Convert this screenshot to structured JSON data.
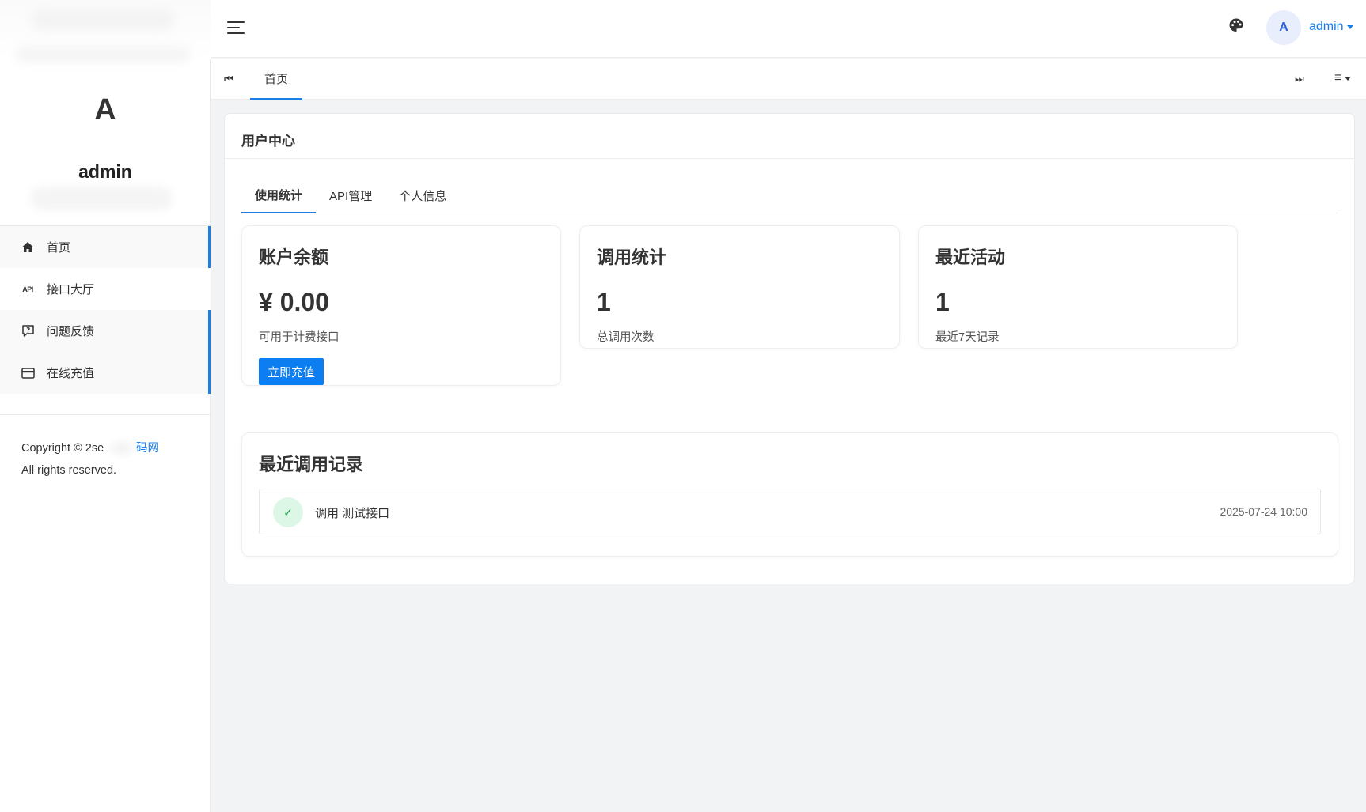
{
  "sidebar": {
    "avatar_letter": "A",
    "username": "admin",
    "items": [
      {
        "label": "首页",
        "icon": "home-icon"
      },
      {
        "label": "接口大厅",
        "icon": "api-icon",
        "icon_text": "API"
      },
      {
        "label": "问题反馈",
        "icon": "feedback-icon"
      },
      {
        "label": "在线充值",
        "icon": "credit-card-icon"
      }
    ],
    "copyright_prefix": "Copyright © 2ser",
    "copyright_link": "码网",
    "copyright_line2": "All rights reserved."
  },
  "header": {
    "avatar_letter": "A",
    "username": "admin"
  },
  "tabbar": {
    "home_tab": "首页"
  },
  "panel": {
    "title": "用户中心",
    "subtabs": [
      "使用统计",
      "API管理",
      "个人信息"
    ],
    "cards": [
      {
        "title": "账户余额",
        "value": "¥ 0.00",
        "desc": "可用于计费接口",
        "button": "立即充值"
      },
      {
        "title": "调用统计",
        "value": "1",
        "desc": "总调用次数"
      },
      {
        "title": "最近活动",
        "value": "1",
        "desc": "最近7天记录"
      }
    ],
    "records": {
      "title": "最近调用记录",
      "items": [
        {
          "text": "调用 测试接口",
          "time": "2025-07-24 10:00"
        }
      ]
    }
  },
  "colors": {
    "accent": "#1a7fe8",
    "button": "#0d7ef2",
    "success_bg": "#dcf7e5",
    "success": "#1a9b4b"
  }
}
